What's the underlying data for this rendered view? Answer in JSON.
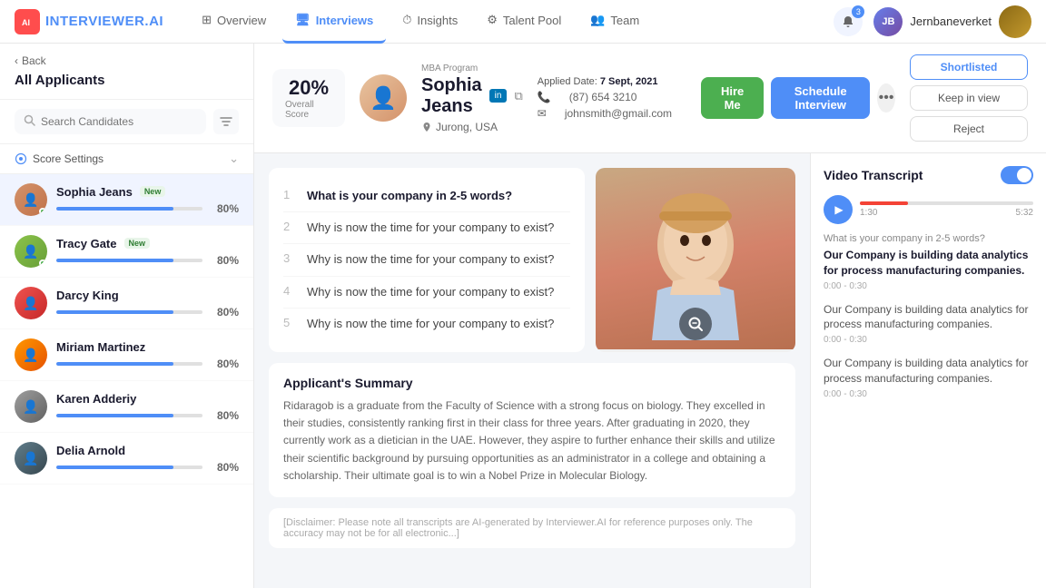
{
  "app": {
    "logo_text": "INTERVIEWER",
    "logo_accent": ".AI",
    "logo_icon": "AI"
  },
  "nav": {
    "items": [
      {
        "id": "overview",
        "label": "Overview",
        "icon": "⊞",
        "active": false
      },
      {
        "id": "interviews",
        "label": "Interviews",
        "icon": "🖥",
        "active": true
      },
      {
        "id": "insights",
        "label": "Insights",
        "icon": "⏱",
        "active": false
      },
      {
        "id": "talent-pool",
        "label": "Talent Pool",
        "icon": "⚙",
        "active": false
      },
      {
        "id": "team",
        "label": "Team",
        "icon": "👥",
        "active": false
      }
    ],
    "notif_count": "3",
    "user_name": "Jernbaneverket"
  },
  "sidebar": {
    "back_label": "Back",
    "title": "All Applicants",
    "search_placeholder": "Search Candidates",
    "score_settings_label": "Score Settings",
    "candidates": [
      {
        "id": 1,
        "name": "Sophia Jeans",
        "score": "80%",
        "score_pct": 80,
        "is_new": true,
        "active": true,
        "color": "#d4926a"
      },
      {
        "id": 2,
        "name": "Tracy Gate",
        "score": "80%",
        "score_pct": 80,
        "is_new": true,
        "active": false,
        "color": "#8bc34a"
      },
      {
        "id": 3,
        "name": "Darcy King",
        "score": "80%",
        "score_pct": 80,
        "is_new": false,
        "active": false,
        "color": "#ef5350"
      },
      {
        "id": 4,
        "name": "Miriam Martinez",
        "score": "80%",
        "score_pct": 80,
        "is_new": false,
        "active": false,
        "color": "#ff9800"
      },
      {
        "id": 5,
        "name": "Karen Adderiy",
        "score": "80%",
        "score_pct": 80,
        "is_new": false,
        "active": false,
        "color": "#9e9e9e"
      },
      {
        "id": 6,
        "name": "Delia Arnold",
        "score": "80%",
        "score_pct": 80,
        "is_new": false,
        "active": false,
        "color": "#607d8b"
      }
    ]
  },
  "profile": {
    "program": "MBA Program",
    "name": "Sophia Jeans",
    "overall_score": "20%",
    "score_label": "Overall Score",
    "location": "Jurong, USA",
    "phone": "(87) 654 3210",
    "email": "johnsmith@gmail.com",
    "applied_date_label": "Applied Date:",
    "applied_date": "7 Sept, 2021",
    "hire_btn": "Hire Me",
    "schedule_btn": "Schedule Interview",
    "shortlisted_btn": "Shortlisted",
    "keep_view_btn": "Keep in view",
    "reject_btn": "Reject",
    "more_btn": "•••"
  },
  "questions": {
    "items": [
      {
        "num": "1",
        "text": "What is your company in 2-5 words?",
        "active": true
      },
      {
        "num": "2",
        "text": "Why is now the time for your company to exist?",
        "active": false
      },
      {
        "num": "3",
        "text": "Why is now the time for your company to exist?",
        "active": false
      },
      {
        "num": "4",
        "text": "Why is now the time for your company to exist?",
        "active": false
      },
      {
        "num": "5",
        "text": "Why is now the time for your company to exist?",
        "active": false
      }
    ]
  },
  "summary": {
    "title": "Applicant's Summary",
    "text": "Ridaragob is a graduate from the Faculty of Science with a strong focus on biology. They excelled in their studies, consistently ranking first in their class for three years. After graduating in 2020, they currently work as a dietician in the UAE. However, they aspire to further enhance their skills and utilize their scientific background by pursuing opportunities as an administrator in a college and obtaining a scholarship. Their ultimate goal is to win a Nobel Prize in Molecular Biology."
  },
  "transcript": {
    "title": "Video Transcript",
    "time_current": "1:30",
    "time_total": "5:32",
    "items": [
      {
        "question": "What is your company in 2-5 words?",
        "answer": "Our Company is building data analytics for process manufacturing companies.",
        "time": "0:00 - 0:30"
      },
      {
        "question": "",
        "answer": "Our Company is building data analytics for process manufacturing companies.",
        "time": "0:00 - 0:30"
      },
      {
        "question": "",
        "answer": "Our Company is building data analytics for process manufacturing companies.",
        "time": "0:00 - 0:30"
      }
    ]
  }
}
